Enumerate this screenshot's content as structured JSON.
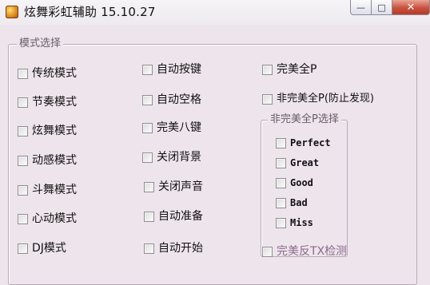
{
  "window": {
    "title": "炫舞彩虹辅助 15.10.27",
    "min_label": "—",
    "max_label": "□",
    "close_label": "✕"
  },
  "mode_group": {
    "legend": "模式选择",
    "col1": [
      "传统模式",
      "节奏模式",
      "炫舞模式",
      "动感模式",
      "斗舞模式",
      "心动模式",
      "DJ模式"
    ],
    "col2": [
      "自动按键",
      "自动空格",
      "完美八键",
      "关闭背景",
      "关闭声音",
      "自动准备",
      "自动开始"
    ],
    "col3": [
      "完美全P",
      "非完美全P(防止发现)",
      "完美反TX检测"
    ]
  },
  "imperfect_group": {
    "legend": "非完美全P选择",
    "options": [
      "Perfect",
      "Great",
      "Good",
      "Bad",
      "Miss"
    ]
  }
}
